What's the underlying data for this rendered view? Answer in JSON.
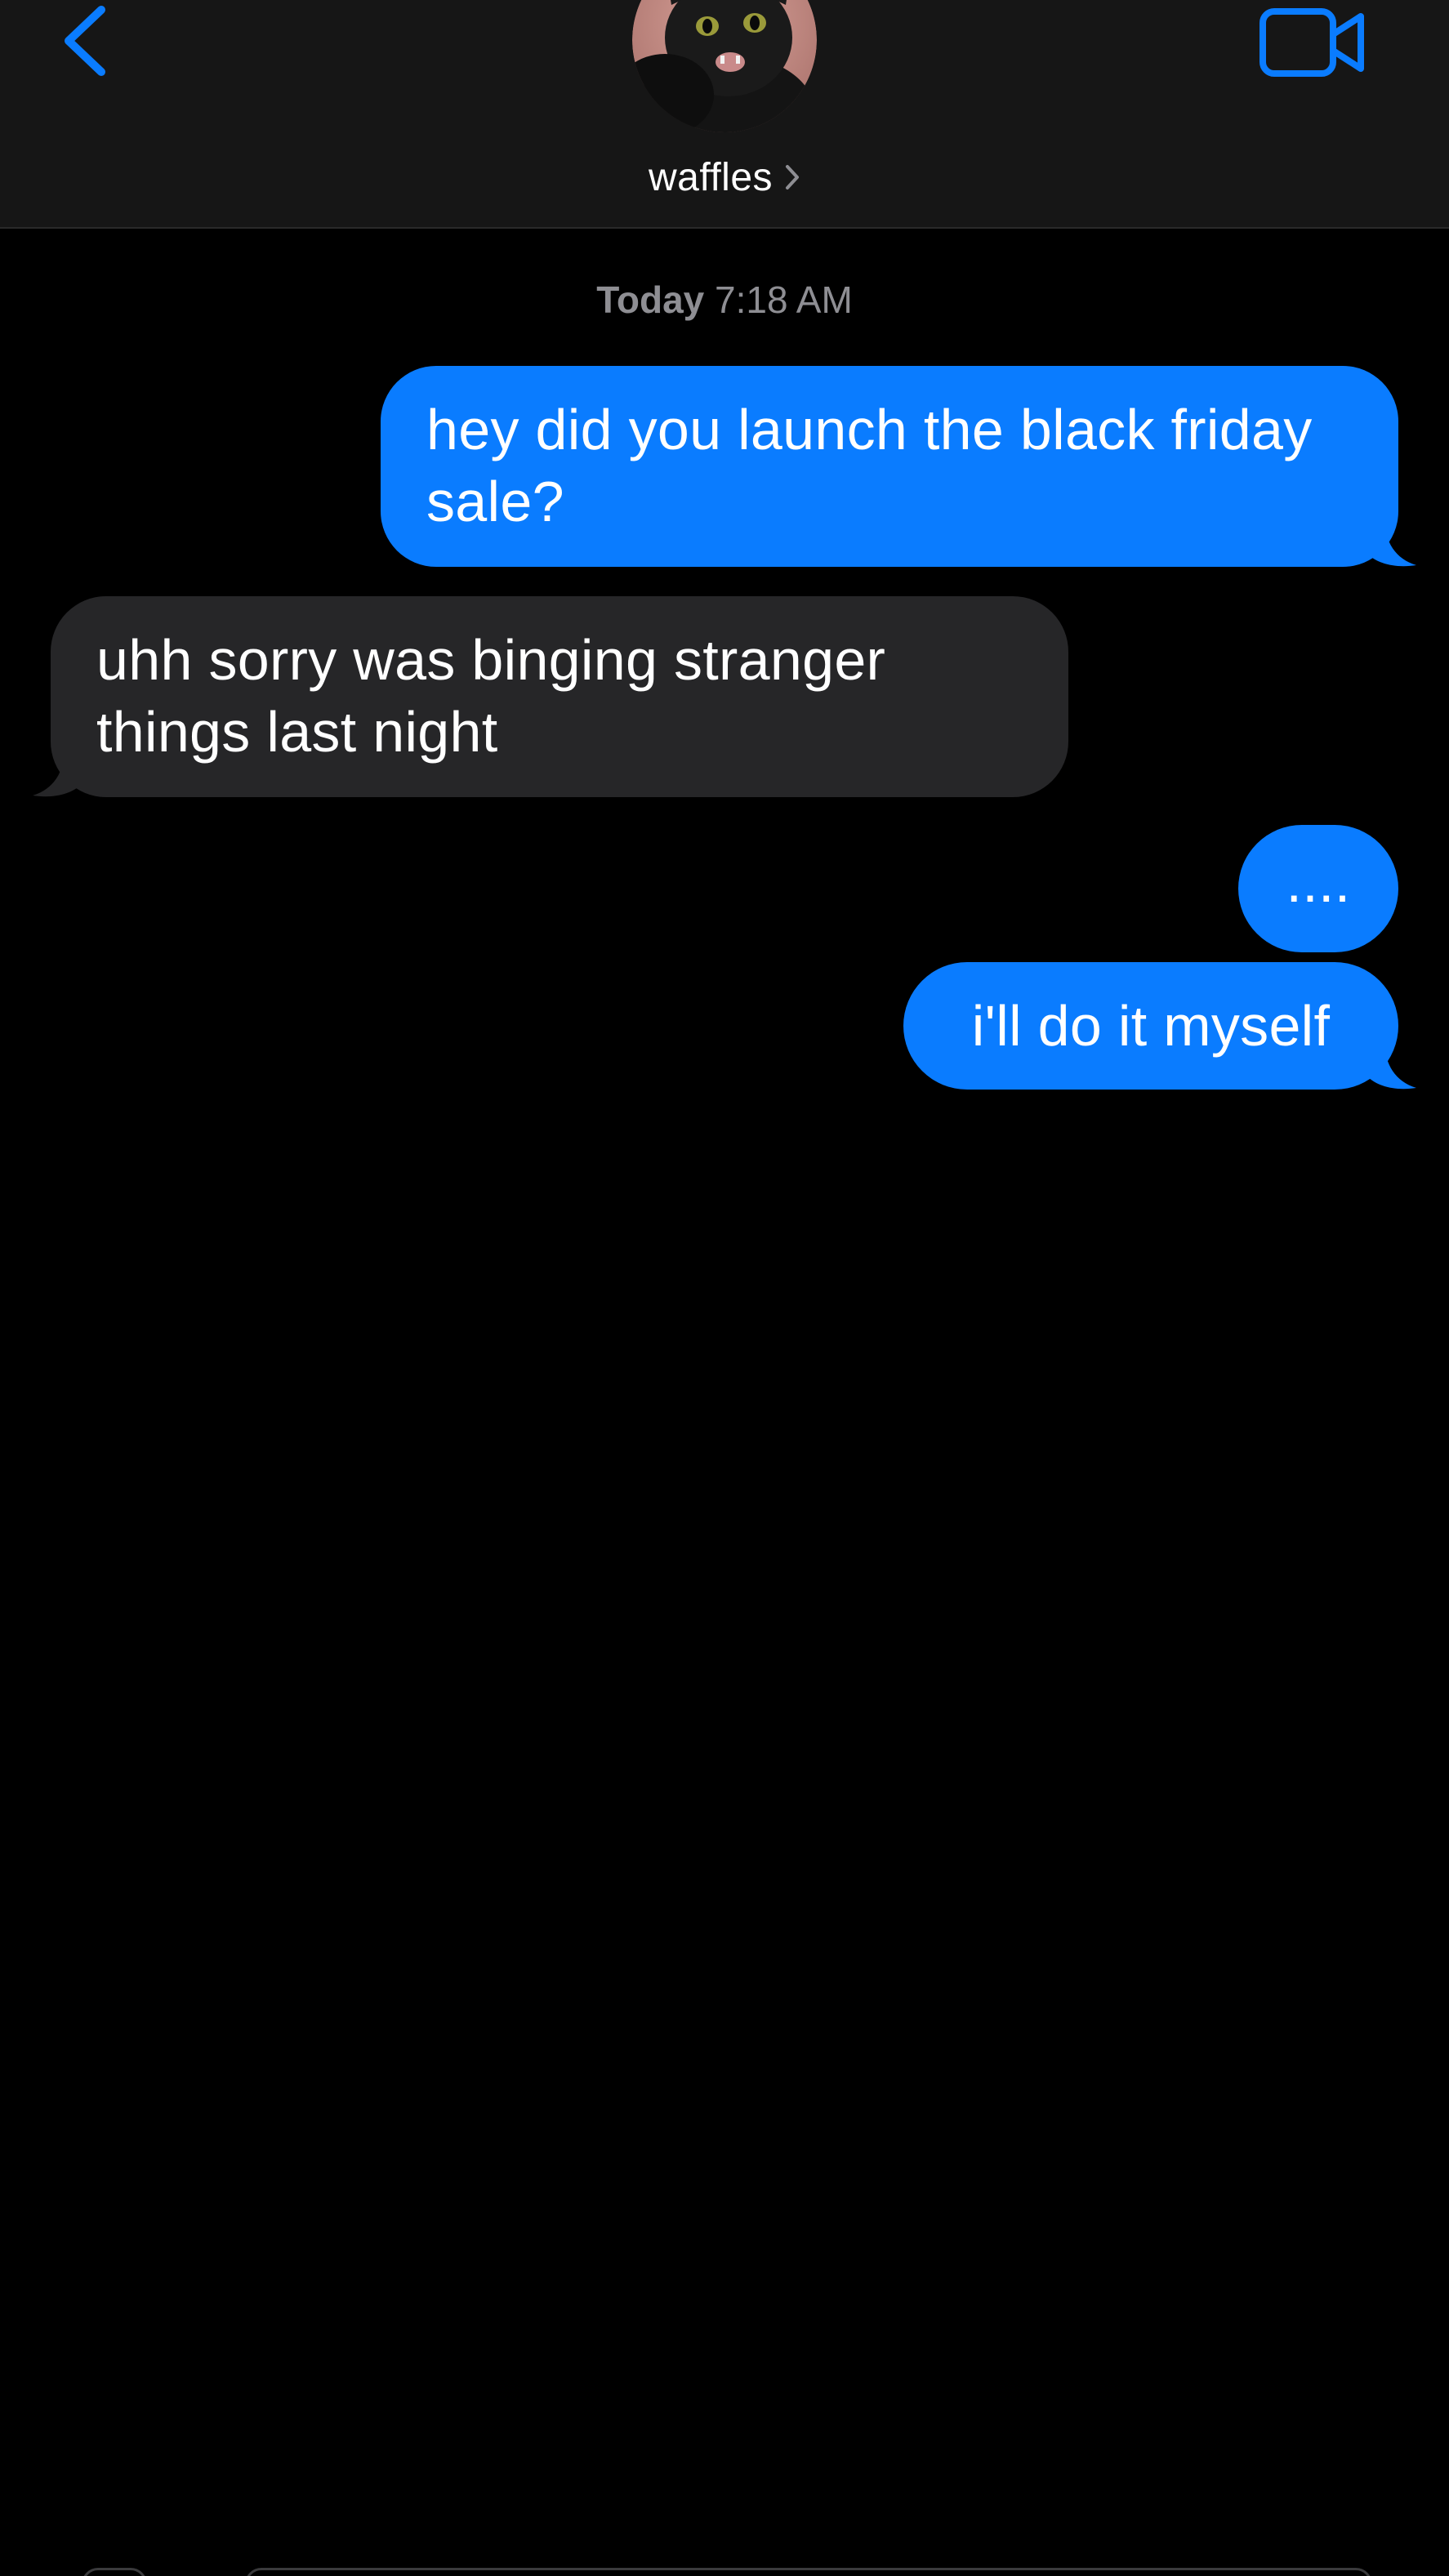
{
  "header": {
    "contact_name": "waffles",
    "back_icon": "chevron-left-icon",
    "video_icon": "video-camera-icon",
    "accent_color": "#0a7cff"
  },
  "timestamp": {
    "day": "Today",
    "time": "7:18 AM"
  },
  "messages": [
    {
      "direction": "sent",
      "text": "hey did you launch the black friday sale?"
    },
    {
      "direction": "received",
      "text": "uhh sorry was binging stranger things last night"
    },
    {
      "direction": "sent",
      "text": "...."
    },
    {
      "direction": "sent",
      "text": "i'll do it myself"
    }
  ],
  "colors": {
    "sent_bubble": "#0a7cff",
    "received_bubble": "#262628",
    "header_bg": "#161616",
    "timestamp": "#8e8e93"
  }
}
